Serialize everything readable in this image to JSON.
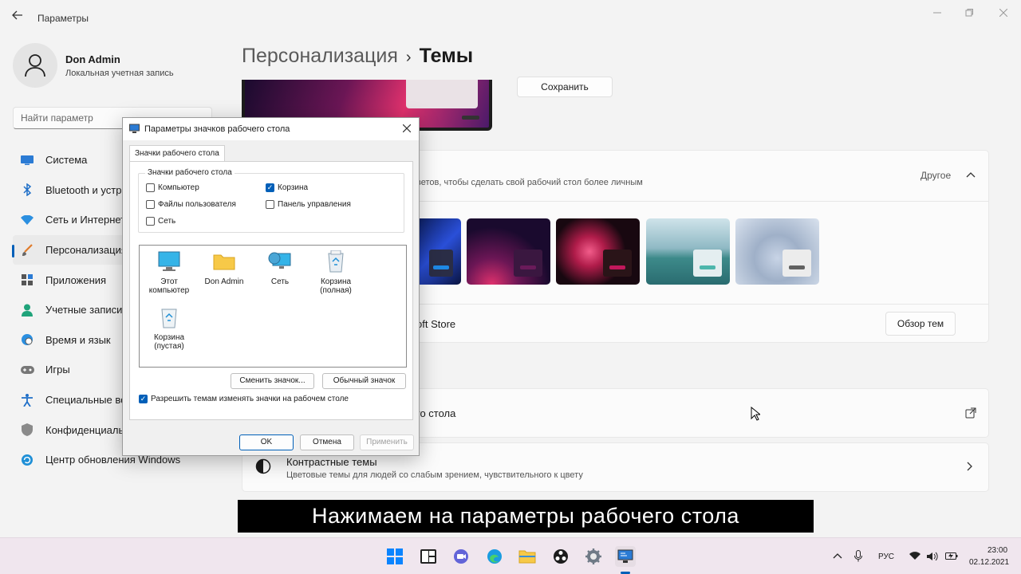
{
  "window": {
    "title": "Параметры"
  },
  "profile": {
    "name": "Don Admin",
    "account_type": "Локальная учетная запись"
  },
  "search": {
    "placeholder": "Найти параметр"
  },
  "sidebar": {
    "items": [
      {
        "label": "Система",
        "icon": "monitor-icon"
      },
      {
        "label": "Bluetooth и устр",
        "icon": "bluetooth-icon"
      },
      {
        "label": "Сеть и Интернет",
        "icon": "wifi-icon"
      },
      {
        "label": "Персонализация",
        "icon": "brush-icon",
        "selected": true
      },
      {
        "label": "Приложения",
        "icon": "apps-icon"
      },
      {
        "label": "Учетные записи",
        "icon": "person-icon"
      },
      {
        "label": "Время и язык",
        "icon": "globe-clock-icon"
      },
      {
        "label": "Игры",
        "icon": "gamepad-icon"
      },
      {
        "label": "Специальные во",
        "icon": "accessibility-icon"
      },
      {
        "label": "Конфиденциальн",
        "icon": "shield-icon"
      },
      {
        "label": "Центр обновления Windows",
        "icon": "update-icon"
      }
    ]
  },
  "breadcrumb": {
    "parent": "Персонализация",
    "separator": "›",
    "current": "Темы"
  },
  "save_button": "Сохранить",
  "themes_card": {
    "description_partial": "ветов, чтобы сделать свой рабочий стол более личным",
    "expand_label": "Другое",
    "store_label_partial": "oft Store",
    "browse_button": "Обзор тем",
    "thumb_colors": [
      "#1e88e5",
      "#6a1b5a",
      "#c2185b",
      "#4db6ac",
      "#616161"
    ]
  },
  "desktop_icons_card": {
    "label_partial": "го стола"
  },
  "contrast_card": {
    "title": "Контрастные темы",
    "subtitle": "Цветовые темы для людей со слабым зрением, чувствительного к цвету"
  },
  "dialog": {
    "title": "Параметры значков рабочего стола",
    "tab": "Значки рабочего стола",
    "group_label": "Значки рабочего стола",
    "checkboxes": [
      {
        "label": "Компьютер",
        "checked": false
      },
      {
        "label": "Корзина",
        "checked": true
      },
      {
        "label": "Файлы пользователя",
        "checked": false
      },
      {
        "label": "Панель управления",
        "checked": false
      },
      {
        "label": "Сеть",
        "checked": false
      }
    ],
    "icons": [
      {
        "label_line1": "Этот",
        "label_line2": "компьютер",
        "icon": "monitor-icon"
      },
      {
        "label_line1": "Don Admin",
        "label_line2": "",
        "icon": "folder-icon"
      },
      {
        "label_line1": "Сеть",
        "label_line2": "",
        "icon": "network-icon"
      },
      {
        "label_line1": "Корзина",
        "label_line2": "(полная)",
        "icon": "recycle-bin-full-icon"
      },
      {
        "label_line1": "Корзина",
        "label_line2": "(пустая)",
        "icon": "recycle-bin-empty-icon"
      }
    ],
    "change_icon_button": "Сменить значок...",
    "default_icon_button": "Обычный значок",
    "allow_themes_label": "Разрешить темам изменять значки на рабочем столе",
    "allow_themes_checked": true,
    "ok_button": "OK",
    "cancel_button": "Отмена",
    "apply_button": "Применить"
  },
  "caption": "Нажимаем на параметры рабочего стола",
  "taskbar": {
    "language": "РУС",
    "time": "23:00",
    "date": "02.12.2021"
  },
  "colors": {
    "accent": "#005fb8",
    "background": "#f3f3f3",
    "taskbar": "#f0e6ee"
  }
}
